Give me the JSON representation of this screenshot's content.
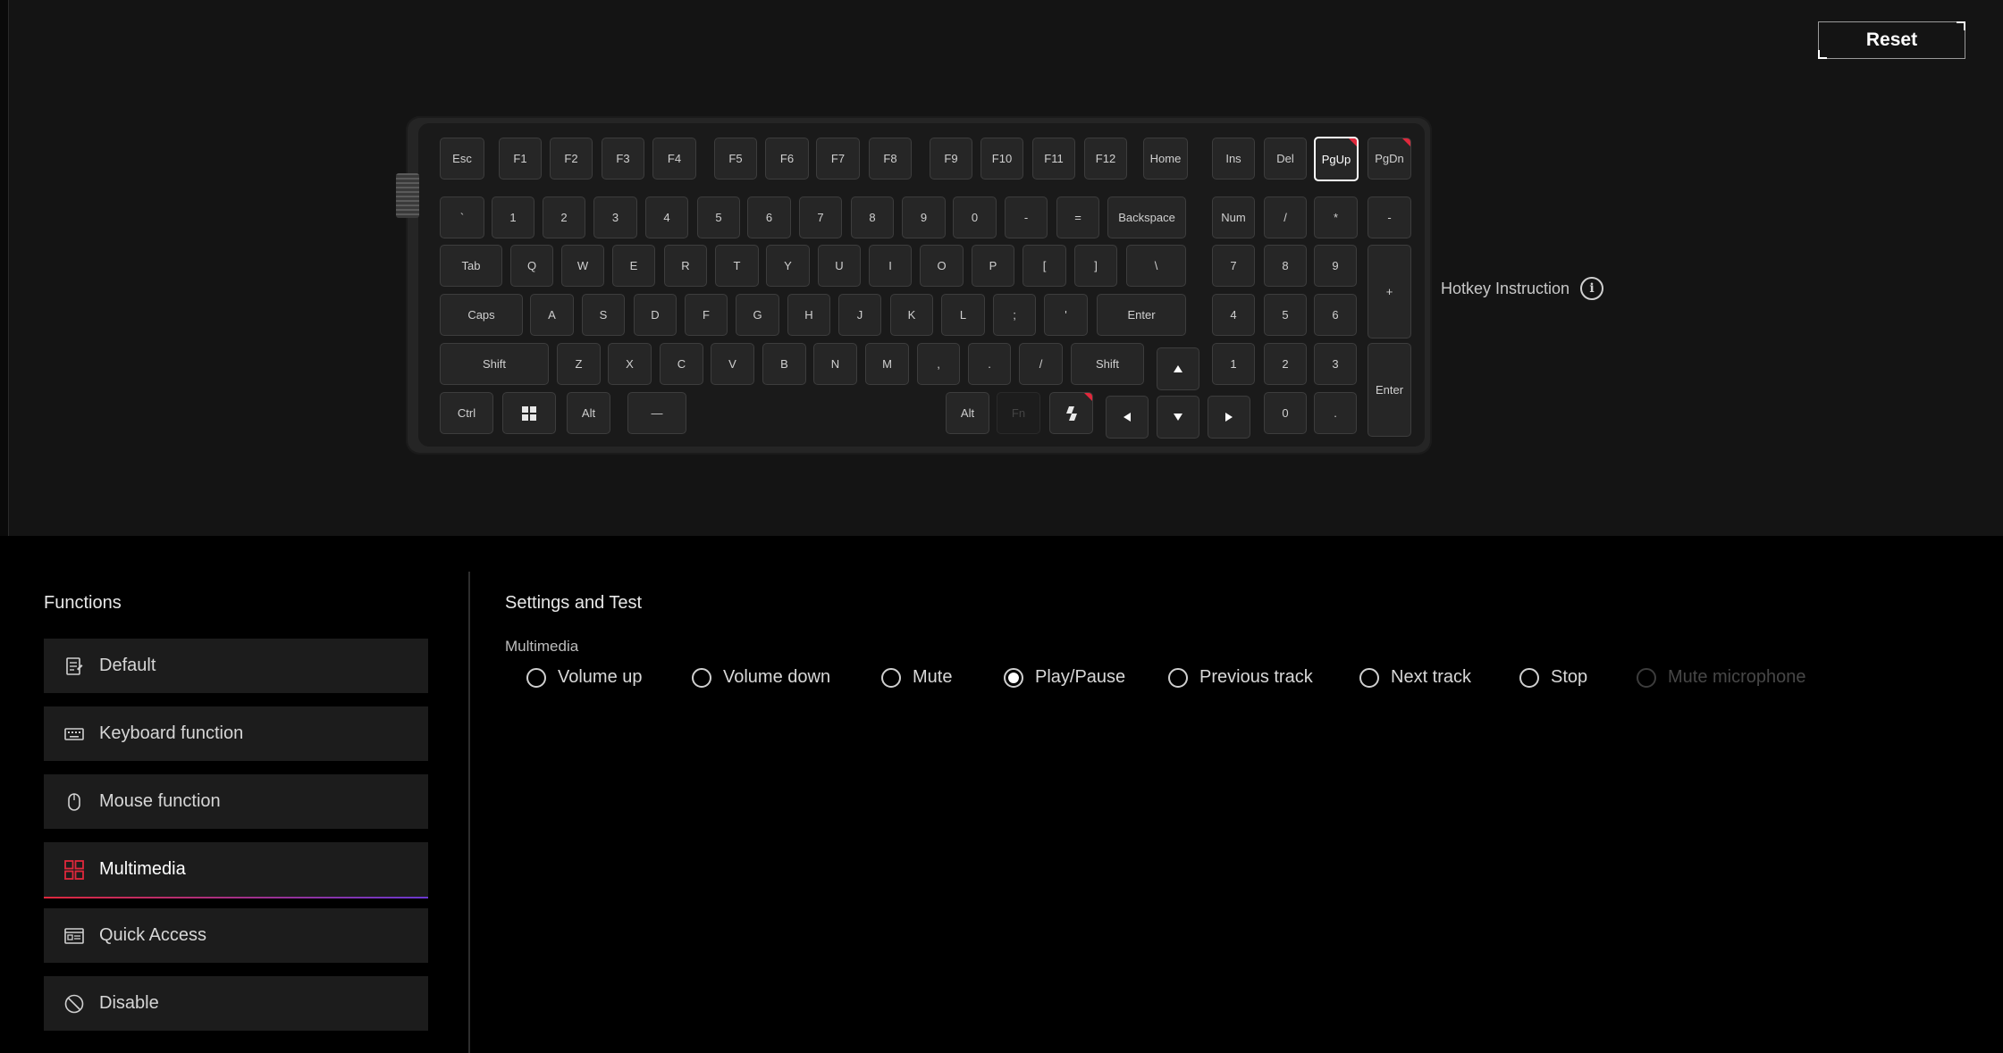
{
  "toolbar": {
    "reset_label": "Reset"
  },
  "hotkey": {
    "label": "Hotkey Instruction",
    "icon": "info-icon"
  },
  "keyboard": {
    "rows": [
      [
        "Esc",
        "F1",
        "F2",
        "F3",
        "F4",
        "F5",
        "F6",
        "F7",
        "F8",
        "F9",
        "F10",
        "F11",
        "F12",
        "Home",
        "Ins",
        "Del",
        "PgUp",
        "PgDn"
      ],
      [
        "`",
        "1",
        "2",
        "3",
        "4",
        "5",
        "6",
        "7",
        "8",
        "9",
        "0",
        "-",
        "=",
        "Backspace",
        "Num",
        "/",
        "*",
        "-"
      ],
      [
        "Tab",
        "Q",
        "W",
        "E",
        "R",
        "T",
        "Y",
        "U",
        "I",
        "O",
        "P",
        "[",
        "]",
        "\\",
        "7",
        "8",
        "9",
        "+"
      ],
      [
        "Caps",
        "A",
        "S",
        "D",
        "F",
        "G",
        "H",
        "J",
        "K",
        "L",
        ";",
        "'",
        "Enter",
        "4",
        "5",
        "6"
      ],
      [
        "Shift",
        "Z",
        "X",
        "C",
        "V",
        "B",
        "N",
        "M",
        ",",
        ".",
        "/",
        "Shift",
        "1",
        "2",
        "3",
        "Enter"
      ],
      [
        "Ctrl",
        "Alt",
        "—",
        "Alt",
        "Fn",
        "0",
        "."
      ]
    ],
    "selected_key": "PgUp",
    "icon_keys": [
      "windows-icon",
      "copilot-icon",
      "arrow-up-icon",
      "arrow-left-icon",
      "arrow-down-icon",
      "arrow-right-icon"
    ],
    "accent_color": "#e0283c"
  },
  "functions": {
    "title": "Functions",
    "items": [
      {
        "label": "Default",
        "icon": "default-icon"
      },
      {
        "label": "Keyboard function",
        "icon": "keyboard-icon"
      },
      {
        "label": "Mouse function",
        "icon": "mouse-icon"
      },
      {
        "label": "Multimedia",
        "icon": "multimedia-icon",
        "active": true
      },
      {
        "label": "Quick Access",
        "icon": "quick-access-icon"
      },
      {
        "label": "Disable",
        "icon": "disable-icon"
      }
    ]
  },
  "settings": {
    "title": "Settings and Test",
    "section_label": "Multimedia",
    "options": [
      {
        "label": "Volume up",
        "checked": false,
        "disabled": false
      },
      {
        "label": "Volume down",
        "checked": false,
        "disabled": false
      },
      {
        "label": "Mute",
        "checked": false,
        "disabled": false
      },
      {
        "label": "Play/Pause",
        "checked": true,
        "disabled": false
      },
      {
        "label": "Previous track",
        "checked": false,
        "disabled": false
      },
      {
        "label": "Next track",
        "checked": false,
        "disabled": false
      },
      {
        "label": "Stop",
        "checked": false,
        "disabled": false
      },
      {
        "label": "Mute microphone",
        "checked": false,
        "disabled": true
      }
    ]
  },
  "colors": {
    "accent_red": "#e0283c",
    "accent_purple": "#6a38d0",
    "panel": "#141414",
    "item_bg": "#1c1c1c"
  }
}
